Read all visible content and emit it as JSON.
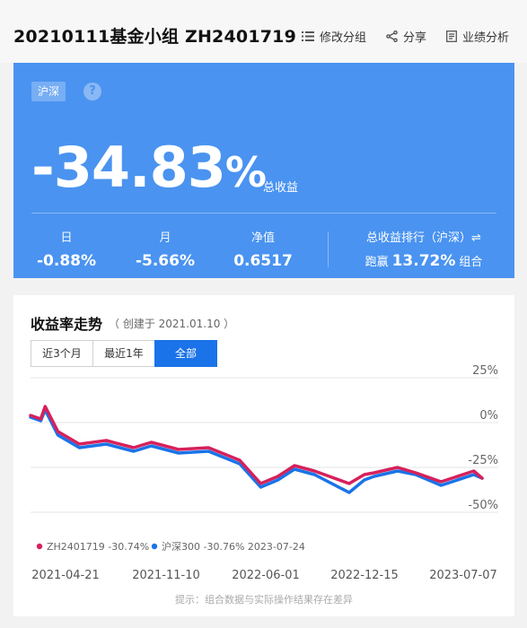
{
  "header": {
    "title": "20210111基金小组 ZH2401719",
    "actions": [
      {
        "label": "修改分组",
        "icon": "list-icon"
      },
      {
        "label": "分享",
        "icon": "share-icon"
      },
      {
        "label": "业绩分析",
        "icon": "report-icon"
      }
    ]
  },
  "hero": {
    "market_tag": "沪深",
    "help": "?",
    "total_return_number": "-34.83",
    "total_return_unit": "%",
    "total_return_label": "总收益",
    "stats": {
      "day": {
        "label": "日",
        "value": "-0.88%"
      },
      "month": {
        "label": "月",
        "value": "-5.66%"
      },
      "nav": {
        "label": "净值",
        "value": "0.6517"
      }
    },
    "rank": {
      "label": "总收益排行（沪深）⇌",
      "prefix": "跑赢",
      "value": "13.72%",
      "suffix": "组合"
    }
  },
  "chart_card": {
    "title": "收益率走势",
    "created": "（ 创建于 2021.01.10 ）",
    "tabs": [
      "近3个月",
      "最近1年",
      "全部"
    ],
    "active_tab": 2,
    "note": "提示：组合数据与实际操作结果存在差异"
  },
  "colors": {
    "accent": "#4a93f0",
    "tab_active": "#1a73e8",
    "series_portfolio": "#d6215b",
    "series_index": "#1a73e8"
  },
  "chart_data": {
    "type": "line",
    "y_ticks": [
      "25%",
      "0%",
      "-25%",
      "-50%"
    ],
    "ylim": [
      -50,
      25
    ],
    "x_ticks": [
      "2021-04-21",
      "2021-11-10",
      "2022-06-01",
      "2022-12-15",
      "2023-07-07"
    ],
    "grid": true,
    "legend_position": "bottom-left",
    "series": [
      {
        "name": "ZH2401719",
        "legend_text": "ZH2401719 -30.74%",
        "color": "#d6215b",
        "x": [
          "2021-01-11",
          "2021-02-01",
          "2021-02-10",
          "2021-03-08",
          "2021-04-21",
          "2021-06-15",
          "2021-08-10",
          "2021-09-15",
          "2021-11-10",
          "2022-01-10",
          "2022-03-15",
          "2022-04-27",
          "2022-06-01",
          "2022-07-05",
          "2022-08-15",
          "2022-10-25",
          "2022-11-25",
          "2022-12-15",
          "2023-02-01",
          "2023-03-10",
          "2023-05-01",
          "2023-07-07",
          "2023-07-24"
        ],
        "values": [
          4,
          2,
          9,
          -5,
          -12,
          -10,
          -14,
          -11,
          -15,
          -14,
          -21,
          -34,
          -30,
          -24,
          -27,
          -34,
          -29,
          -28,
          -25,
          -28,
          -33,
          -27,
          -31
        ]
      },
      {
        "name": "沪深300",
        "legend_text": "沪深300 -30.76% 2023-07-24",
        "color": "#1a73e8",
        "x": [
          "2021-01-11",
          "2021-02-01",
          "2021-02-10",
          "2021-03-08",
          "2021-04-21",
          "2021-06-15",
          "2021-08-10",
          "2021-09-15",
          "2021-11-10",
          "2022-01-10",
          "2022-03-15",
          "2022-04-27",
          "2022-06-01",
          "2022-07-05",
          "2022-08-15",
          "2022-10-25",
          "2022-11-25",
          "2022-12-15",
          "2023-02-01",
          "2023-03-10",
          "2023-05-01",
          "2023-07-07",
          "2023-07-24"
        ],
        "values": [
          3,
          1,
          7,
          -7,
          -14,
          -12,
          -16,
          -13,
          -17,
          -16,
          -23,
          -36,
          -32,
          -26,
          -29,
          -39,
          -32,
          -30,
          -27,
          -29,
          -35,
          -29,
          -31
        ]
      }
    ]
  }
}
